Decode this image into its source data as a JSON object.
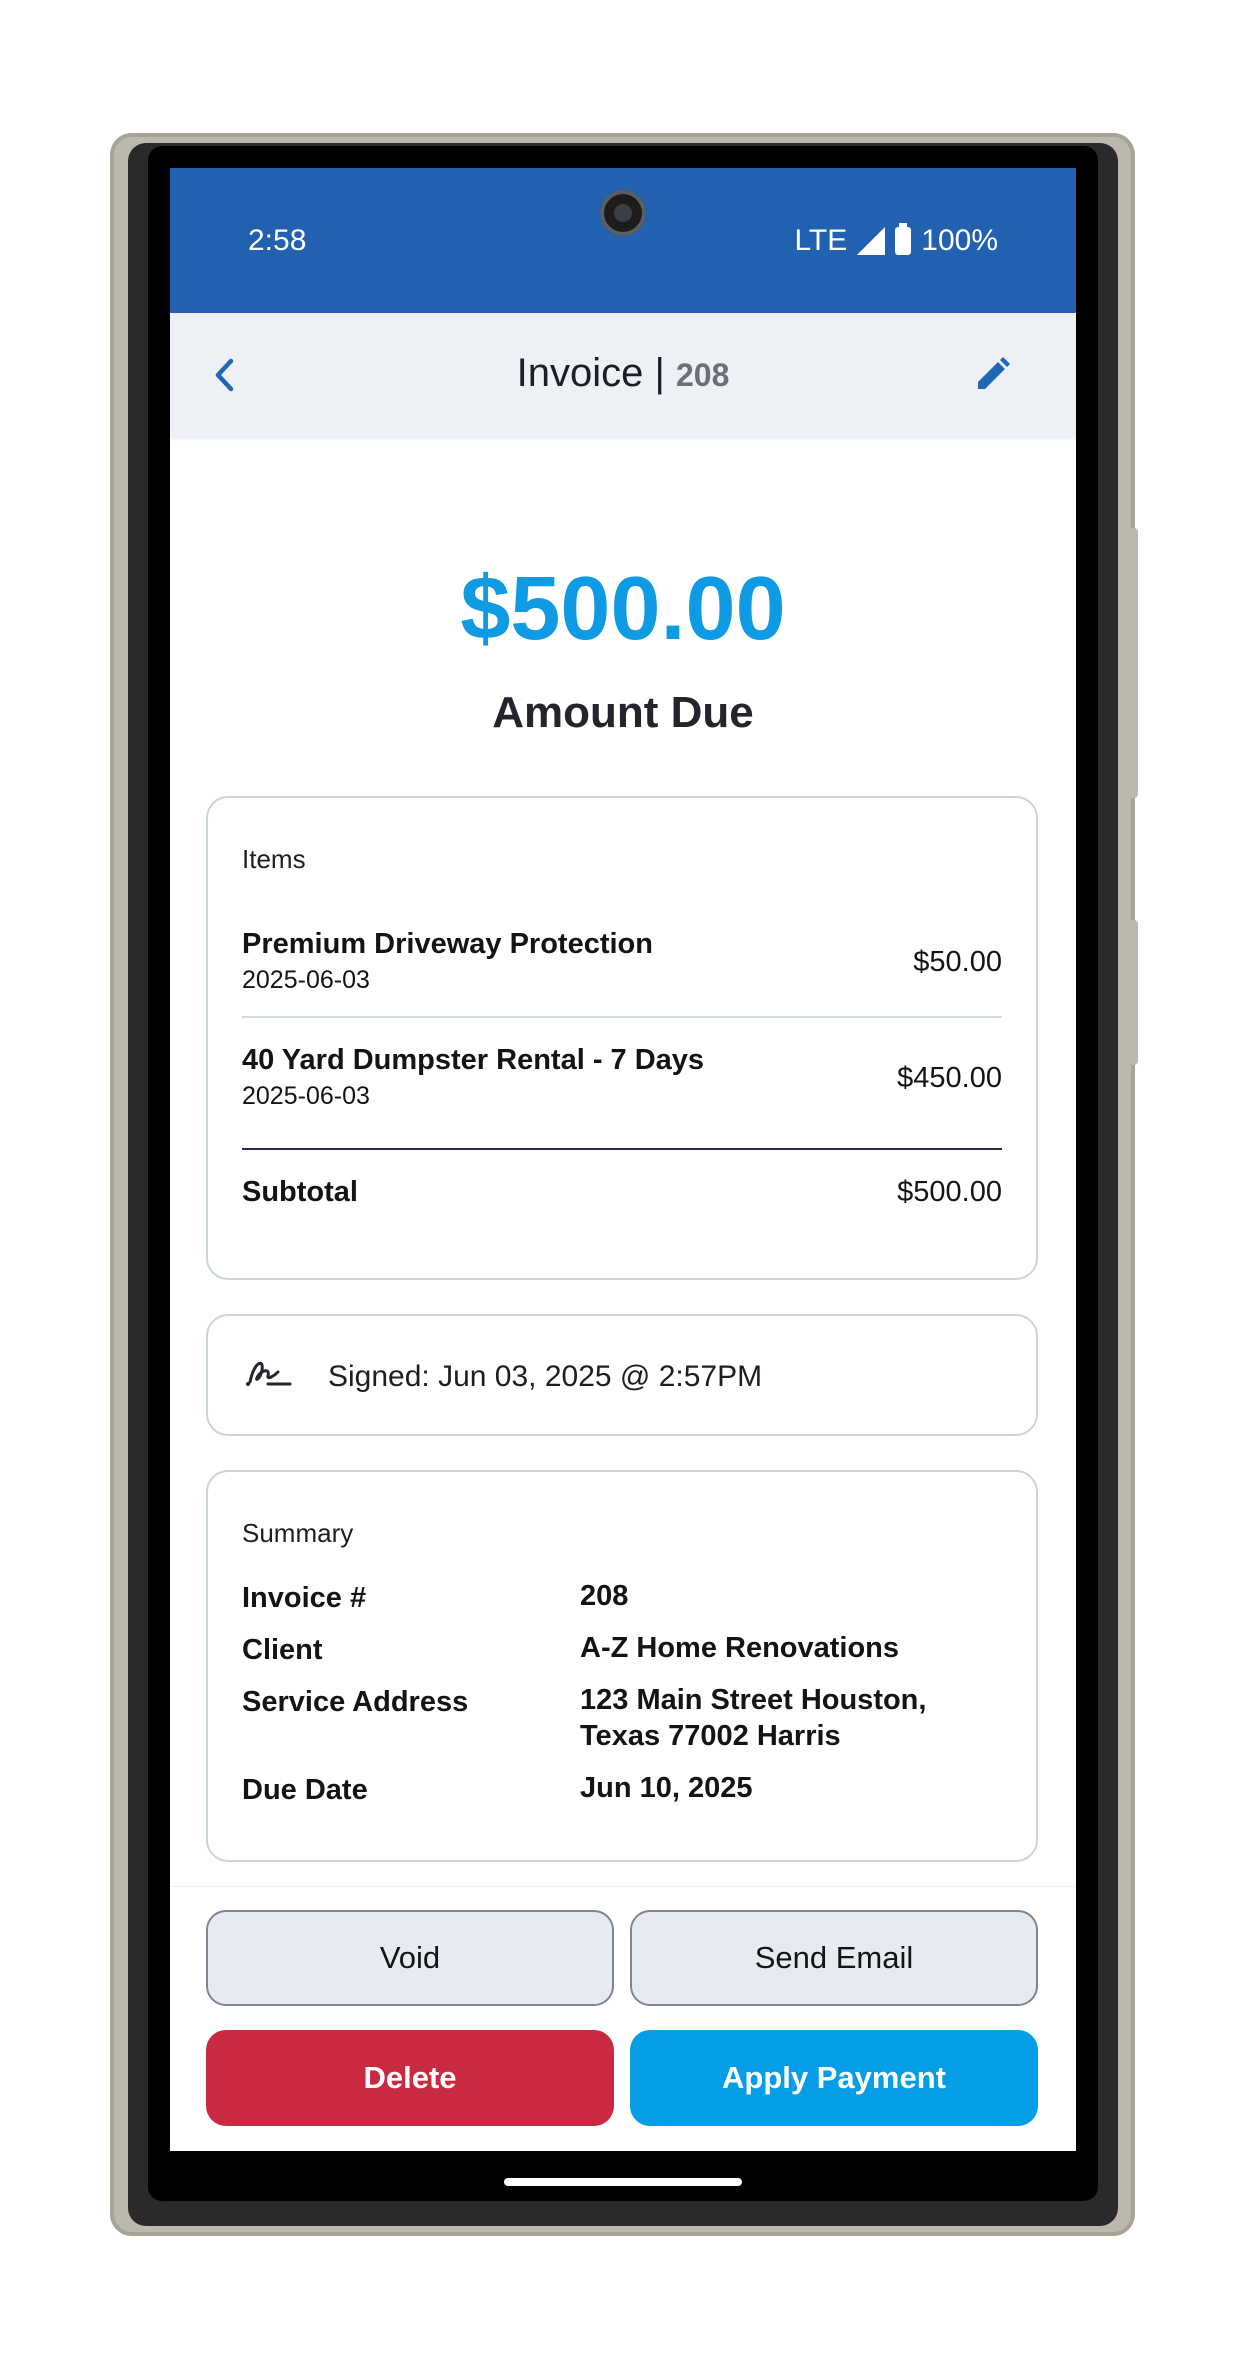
{
  "status_bar": {
    "time": "2:58",
    "network": "LTE",
    "battery": "100%"
  },
  "header": {
    "title": "Invoice |",
    "invoice_number": "208",
    "back_icon": "chevron-left-icon",
    "edit_icon": "pencil-icon"
  },
  "amount": {
    "value": "$500.00",
    "label": "Amount Due"
  },
  "items": {
    "heading": "Items",
    "rows": [
      {
        "name": "Premium Driveway Protection",
        "date": "2025-06-03",
        "price": "$50.00"
      },
      {
        "name": "40 Yard Dumpster Rental - 7 Days",
        "date": "2025-06-03",
        "price": "$450.00"
      }
    ],
    "subtotal_label": "Subtotal",
    "subtotal_value": "$500.00"
  },
  "signature": {
    "icon": "signature-icon",
    "text": "Signed: Jun 03, 2025 @ 2:57PM"
  },
  "summary": {
    "heading": "Summary",
    "invoice_label": "Invoice #",
    "invoice_value": "208",
    "client_label": "Client",
    "client_value": "A-Z Home Renovations",
    "address_label": "Service Address",
    "address_line1": "123 Main Street Houston,",
    "address_line2": "Texas 77002 Harris",
    "due_label": "Due Date",
    "due_value": "Jun 10, 2025"
  },
  "actions": {
    "void": "Void",
    "send_email": "Send Email",
    "delete": "Delete",
    "apply_payment": "Apply Payment"
  },
  "colors": {
    "status_bar": "#2161b0",
    "accent": "#0f9be3",
    "danger": "#c92a41",
    "primary_button": "#059ee6"
  }
}
